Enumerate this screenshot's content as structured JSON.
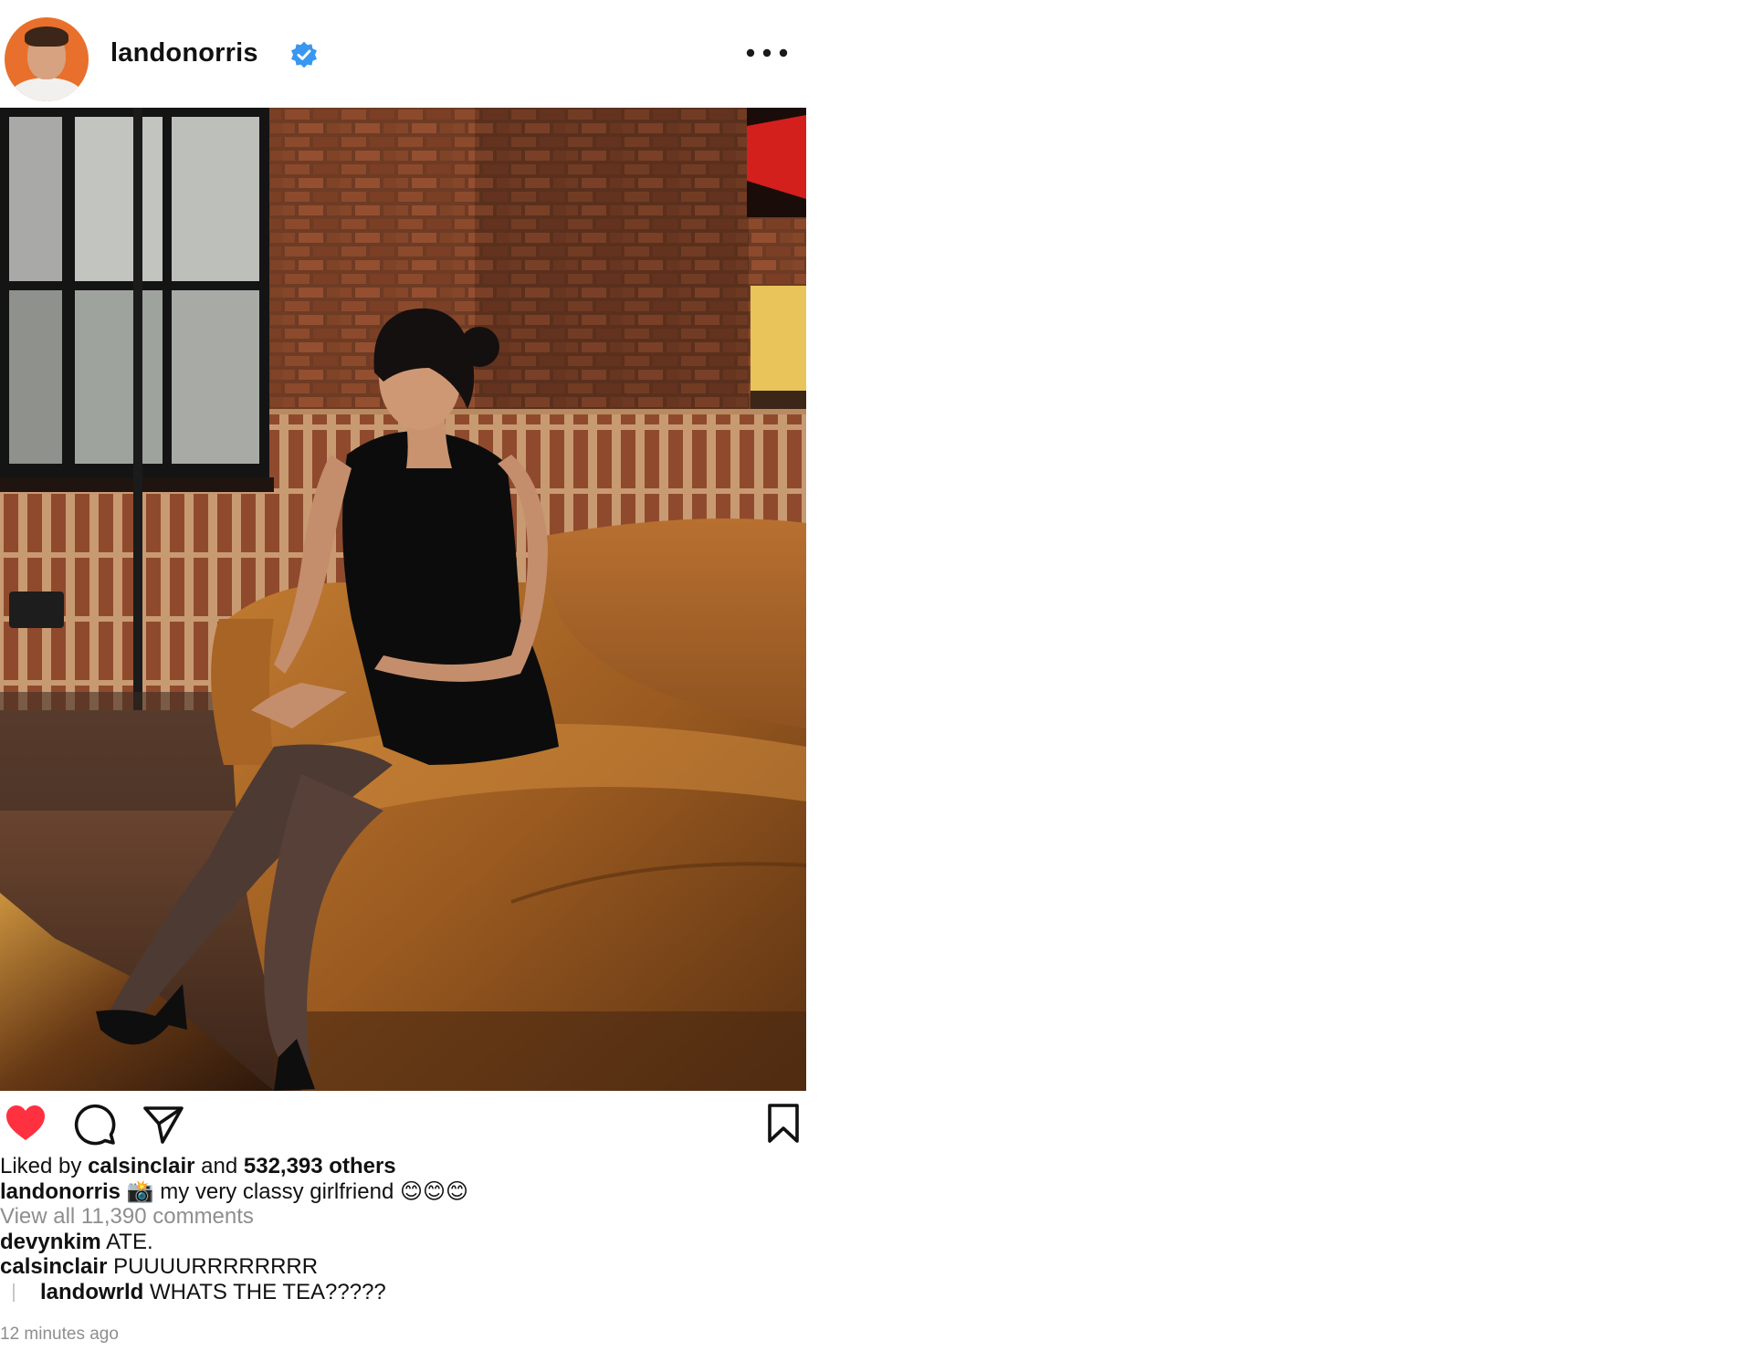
{
  "header": {
    "username": "landonorris",
    "verified_icon": "verified-badge-icon",
    "more_icon": "more-options-icon"
  },
  "post": {
    "image_description_icon": "photo",
    "liked_by_prefix": "Liked by",
    "liked_by_user": "calsinclair",
    "liked_by_and": "and",
    "liked_by_count": "532,393 others",
    "caption_user": "landonorris",
    "caption_text": "📸 my very classy girlfriend 😊😊😊",
    "view_comments": "View all 11,390 comments",
    "comments": [
      {
        "user": "devynkim",
        "text": "ATE."
      },
      {
        "user": "calsinclair",
        "text": "PUUUURRRRRRRR"
      }
    ],
    "reply": {
      "user": "landowrld",
      "text": "WHATS THE TEA?????"
    },
    "timestamp": "12 minutes ago"
  },
  "actions": {
    "like_icon": "heart-icon",
    "comment_icon": "comment-icon",
    "share_icon": "send-icon",
    "save_icon": "bookmark-icon"
  },
  "colors": {
    "like_red": "#ff3040",
    "verified_blue": "#3897f0",
    "muted_text": "#8e8e8e",
    "avatar_orange": "#e8702c"
  }
}
